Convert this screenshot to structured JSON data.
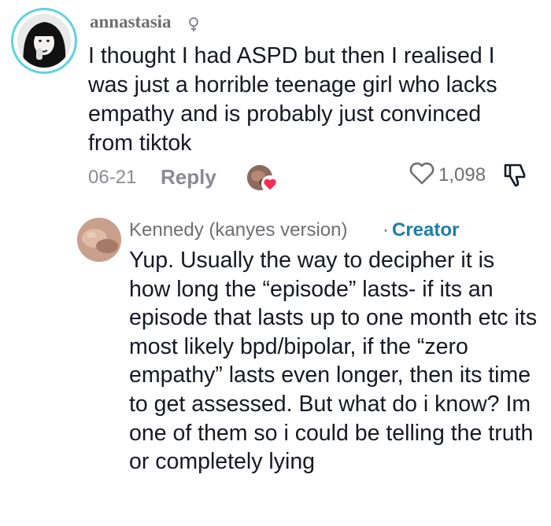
{
  "comments": [
    {
      "username": "annastasia",
      "text": "I thought I had ASPD but then I realised I was just a horrible teenage girl who lacks empathy and is probably just convinced from tiktok",
      "date": "06-21",
      "reply_label": "Reply",
      "like_count": "1,098"
    },
    {
      "username": "Kennedy (kanyes version)",
      "separator": "·",
      "badge": "Creator",
      "text": "Yup. Usually the way to decipher it is how long the “episode” lasts- if its an episode that lasts up to one month etc its most likely bpd/bipolar, if the “zero empathy” lasts even longer, then its time to get assessed. But what do i know? Im one of them so i could be telling the truth or completely lying"
    }
  ],
  "colors": {
    "avatar_ring": "#5fd3e0",
    "creator_badge": "#1e7ea6",
    "liked_heart": "#fe2c55",
    "meta_text": "#8a8b91"
  },
  "icons": {
    "user_icon": "profile-pronoun-icon",
    "like_icon": "heart-outline-icon",
    "dislike_icon": "thumbs-down-icon",
    "liker_heart": "heart-filled-icon"
  }
}
